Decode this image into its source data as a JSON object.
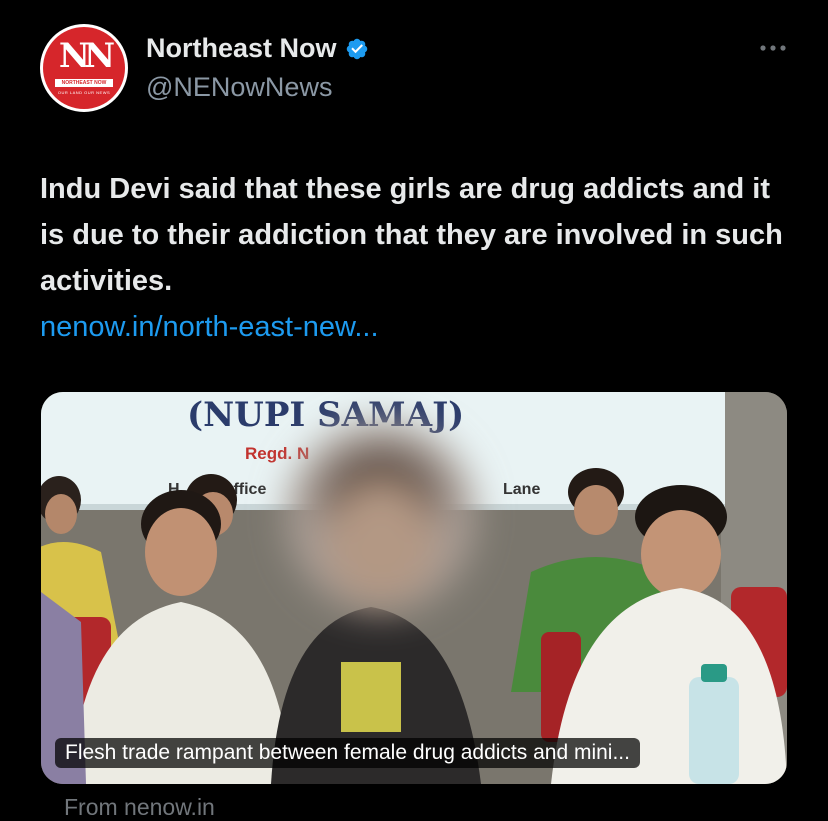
{
  "account": {
    "display_name": "Northeast Now",
    "handle": "@NENowNews",
    "verified": true,
    "avatar_logo": {
      "text": "NN",
      "band": "NORTHEAST NOW",
      "tagline": "OUR LAND OUR NEWS"
    }
  },
  "tweet": {
    "text": "Indu Devi said that these girls are drug addicts and it is due to their addiction that they are involved in such activities.",
    "link_text": "nenow.in/north-east-new..."
  },
  "card": {
    "banner_title": "(NUPI SAMAJ)",
    "banner_regd": "Regd. N",
    "banner_office": "Office",
    "banner_ho": "H",
    "banner_lane": "Lane",
    "caption": "Flesh trade rampant between female drug addicts and mini...",
    "source": "From nenow.in"
  },
  "icons": {
    "verified": "verified-badge-icon",
    "more": "more-options-icon"
  },
  "colors": {
    "background": "#000000",
    "text": "#e7e9ea",
    "muted": "#8b98a5",
    "link": "#1d9bf0",
    "brand_red": "#d6262b"
  }
}
